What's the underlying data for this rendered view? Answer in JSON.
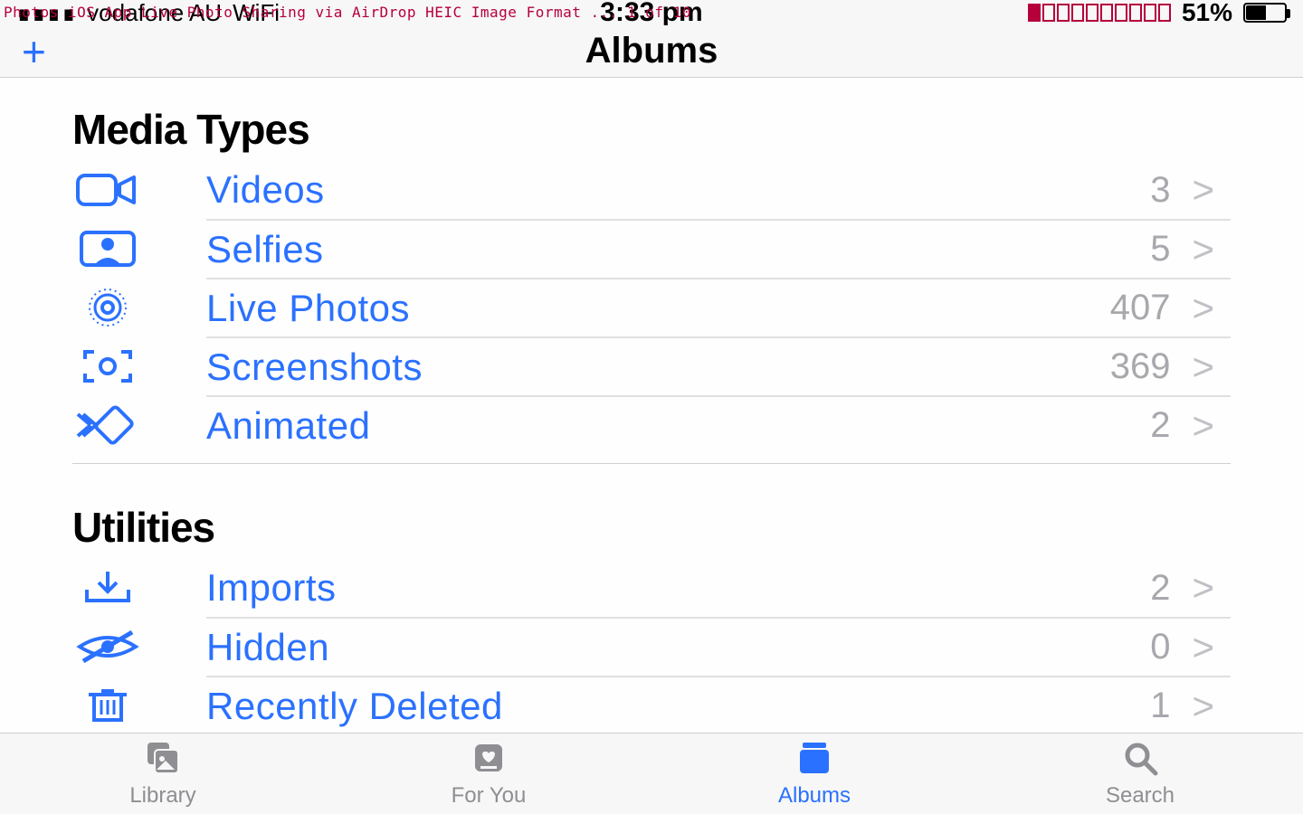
{
  "overlay": "Photos iOS App Live Photo Sharing via AirDrop HEIC Image Format ... 1 of 10",
  "status_bar": {
    "carrier": "vodafone AU",
    "wifi": "WiFi",
    "time": "3:33 pm",
    "battery_percent": "51%"
  },
  "nav": {
    "title": "Albums",
    "add": "+"
  },
  "sections": [
    {
      "title": "Media Types",
      "rows": [
        {
          "icon": "video-icon",
          "label": "Videos",
          "count": "3"
        },
        {
          "icon": "selfies-icon",
          "label": "Selfies",
          "count": "5"
        },
        {
          "icon": "livephotos-icon",
          "label": "Live Photos",
          "count": "407"
        },
        {
          "icon": "screenshots-icon",
          "label": "Screenshots",
          "count": "369"
        },
        {
          "icon": "animated-icon",
          "label": "Animated",
          "count": "2"
        }
      ]
    },
    {
      "title": "Utilities",
      "rows": [
        {
          "icon": "imports-icon",
          "label": "Imports",
          "count": "2"
        },
        {
          "icon": "hidden-icon",
          "label": "Hidden",
          "count": "0"
        },
        {
          "icon": "recentlydeleted-icon",
          "label": "Recently Deleted",
          "count": "1"
        }
      ]
    }
  ],
  "tabs": [
    {
      "id": "library",
      "label": "Library",
      "active": false
    },
    {
      "id": "foryou",
      "label": "For You",
      "active": false
    },
    {
      "id": "albums",
      "label": "Albums",
      "active": true
    },
    {
      "id": "search",
      "label": "Search",
      "active": false
    }
  ]
}
